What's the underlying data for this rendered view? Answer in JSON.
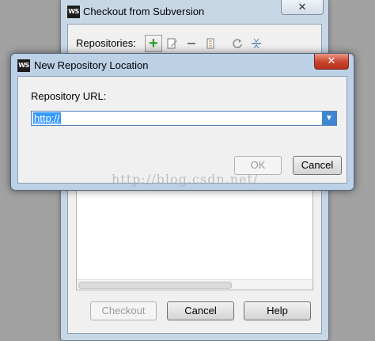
{
  "checkout_dialog": {
    "title": "Checkout from Subversion",
    "close_label": "✕",
    "repositories_label": "Repositories:",
    "buttons": {
      "checkout": "Checkout",
      "cancel": "Cancel",
      "help": "Help"
    }
  },
  "new_repo_dialog": {
    "title": "New Repository Location",
    "close_label": "✕",
    "url_label": "Repository URL:",
    "url_value": "http://",
    "ok_label": "OK",
    "cancel_label": "Cancel"
  },
  "app_logo": "WS",
  "watermark": "http://blog.csdn.net/",
  "icons": {
    "add": "plus-icon",
    "edit": "edit-icon",
    "remove": "minus-icon",
    "info": "document-icon",
    "refresh": "refresh-icon",
    "collapse": "collapse-icon"
  },
  "colors": {
    "title_bar": "#c8d7e6",
    "close_button": "#c8432c",
    "selection": "#3399ff",
    "add_icon": "#2c9c2c"
  }
}
